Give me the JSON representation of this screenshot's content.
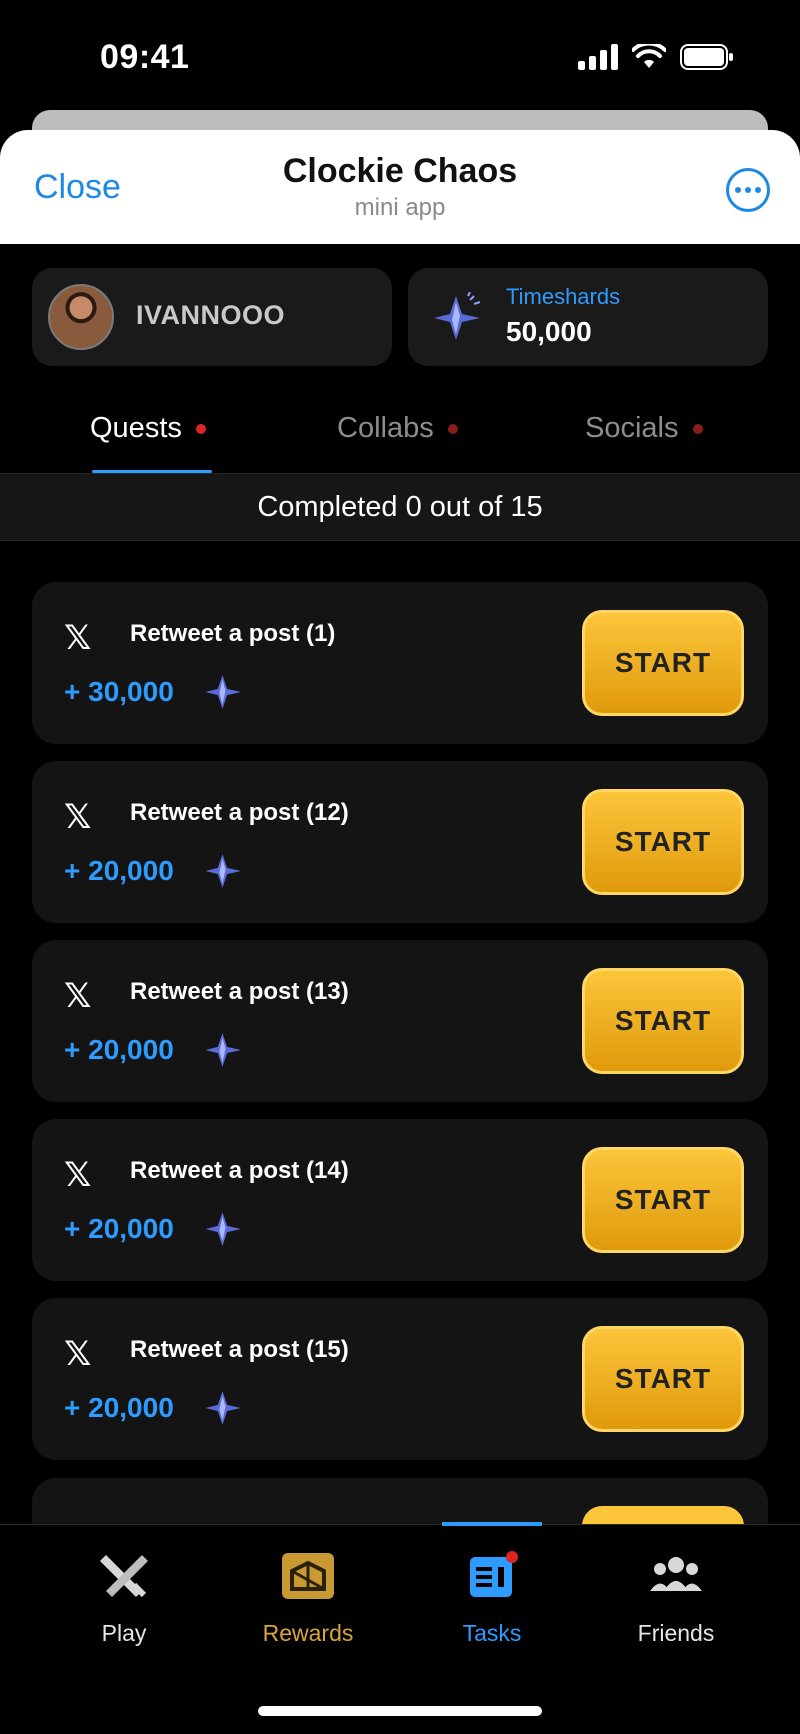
{
  "status": {
    "time": "09:41"
  },
  "header": {
    "close_label": "Close",
    "title": "Clockie Chaos",
    "subtitle": "mini app"
  },
  "user": {
    "name": "IVANNOOO"
  },
  "currency": {
    "label": "Timeshards",
    "value": "50,000"
  },
  "tabs": [
    {
      "label": "Quests",
      "active": true
    },
    {
      "label": "Collabs",
      "active": false
    },
    {
      "label": "Socials",
      "active": false
    }
  ],
  "progress": {
    "text": "Completed 0 out of 15"
  },
  "quests": [
    {
      "title": "Retweet a post (1)",
      "reward": "+ 30,000",
      "button": "START"
    },
    {
      "title": "Retweet a post (12)",
      "reward": "+ 20,000",
      "button": "START"
    },
    {
      "title": "Retweet a post (13)",
      "reward": "+ 20,000",
      "button": "START"
    },
    {
      "title": "Retweet a post (14)",
      "reward": "+ 20,000",
      "button": "START"
    },
    {
      "title": "Retweet a post (15)",
      "reward": "+ 20,000",
      "button": "START"
    }
  ],
  "nav": [
    {
      "label": "Play",
      "icon": "swords-icon"
    },
    {
      "label": "Rewards",
      "icon": "chest-icon"
    },
    {
      "label": "Tasks",
      "icon": "tasks-icon",
      "active": true
    },
    {
      "label": "Friends",
      "icon": "friends-icon"
    }
  ],
  "colors": {
    "accent": "#2e9bff",
    "gold": "#fcc53a",
    "rewards": "#d9a43a",
    "background": "#000000"
  }
}
